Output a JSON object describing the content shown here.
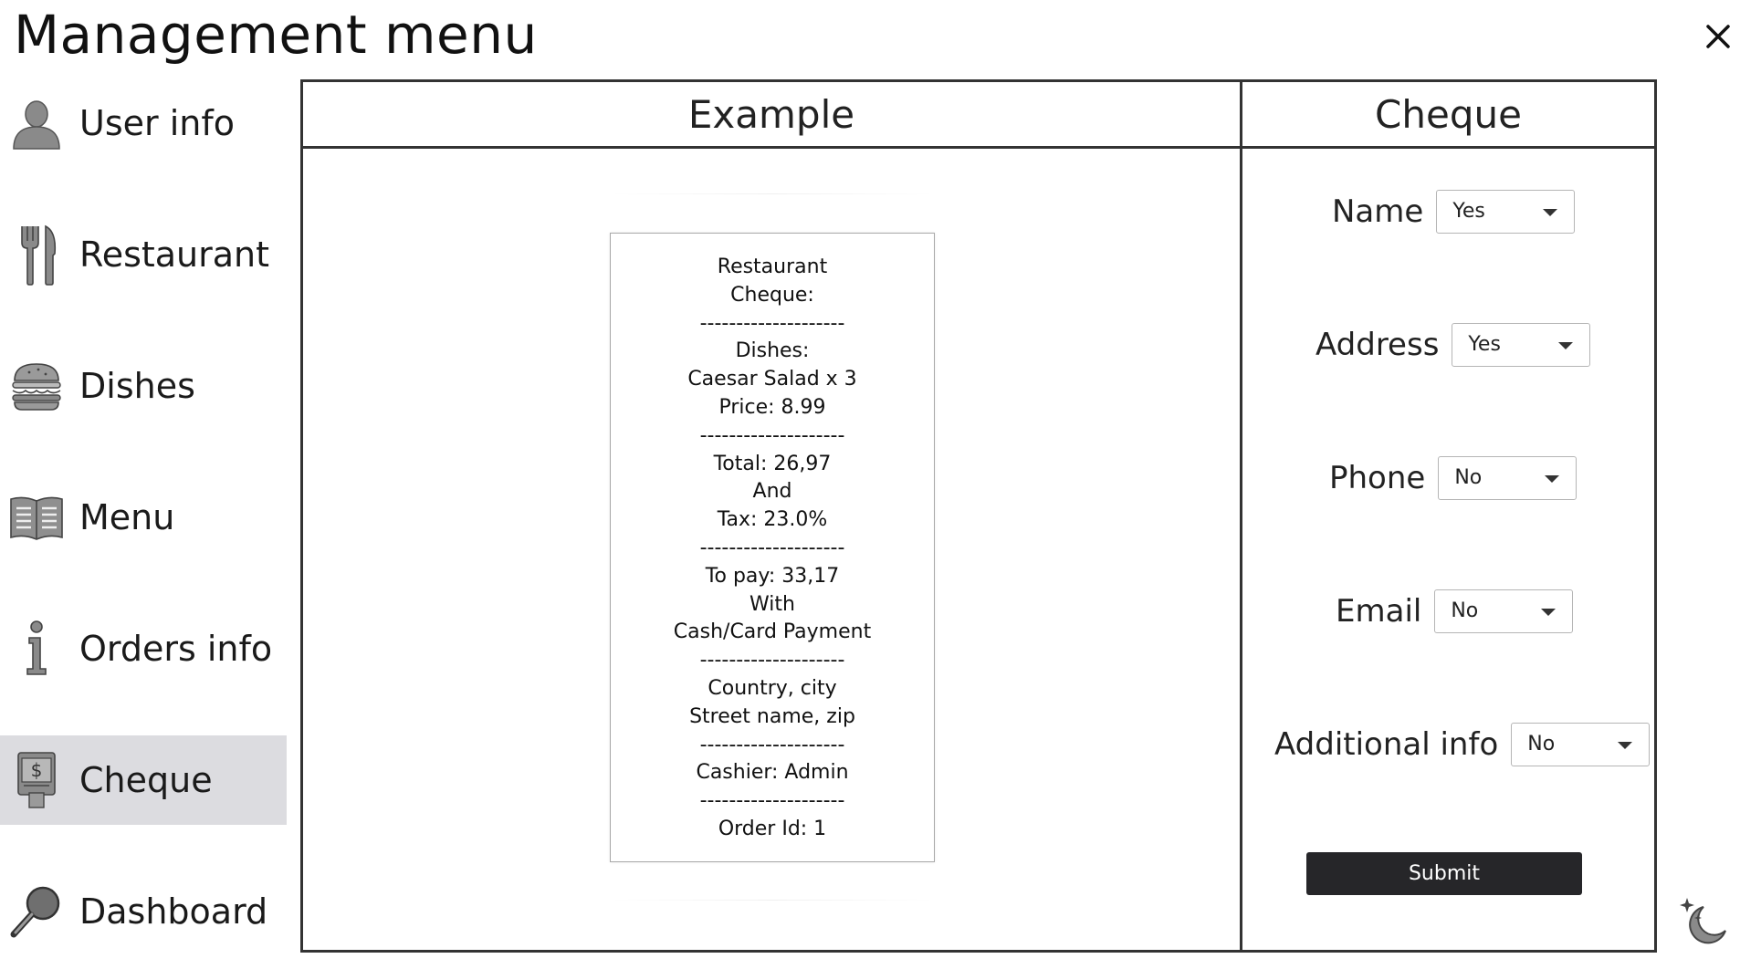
{
  "window": {
    "title": "Management menu"
  },
  "sidebar": {
    "items": [
      {
        "label": "User info",
        "icon": "user-icon"
      },
      {
        "label": "Restaurant",
        "icon": "fork-knife-icon"
      },
      {
        "label": "Dishes",
        "icon": "burger-icon"
      },
      {
        "label": "Menu",
        "icon": "book-icon"
      },
      {
        "label": "Orders info",
        "icon": "info-icon"
      },
      {
        "label": "Cheque",
        "icon": "cash-register-icon",
        "active": true
      },
      {
        "label": "Dashboard",
        "icon": "magnifier-icon"
      }
    ]
  },
  "example": {
    "heading": "Example",
    "receipt_lines": [
      "Restaurant",
      "Cheque:",
      "--------------------",
      "Dishes:",
      "Caesar Salad x 3",
      "Price: 8.99",
      "--------------------",
      "Total: 26,97",
      "And",
      "Tax: 23.0%",
      "--------------------",
      "To pay: 33,17",
      "With",
      "Cash/Card Payment",
      "--------------------",
      "Country, city",
      "Street name, zip",
      "--------------------",
      "Cashier: Admin",
      "--------------------",
      "Order Id: 1"
    ]
  },
  "cheque": {
    "heading": "Cheque",
    "fields": [
      {
        "label": "Name",
        "value": "Yes"
      },
      {
        "label": "Address",
        "value": "Yes"
      },
      {
        "label": "Phone",
        "value": "No"
      },
      {
        "label": "Email",
        "value": "No"
      },
      {
        "label": "Additional info",
        "value": "No"
      }
    ],
    "submit_label": "Submit"
  },
  "colors": {
    "active_item_bg": "#dcdce0",
    "submit_bg": "#262629",
    "border": "#333333"
  }
}
